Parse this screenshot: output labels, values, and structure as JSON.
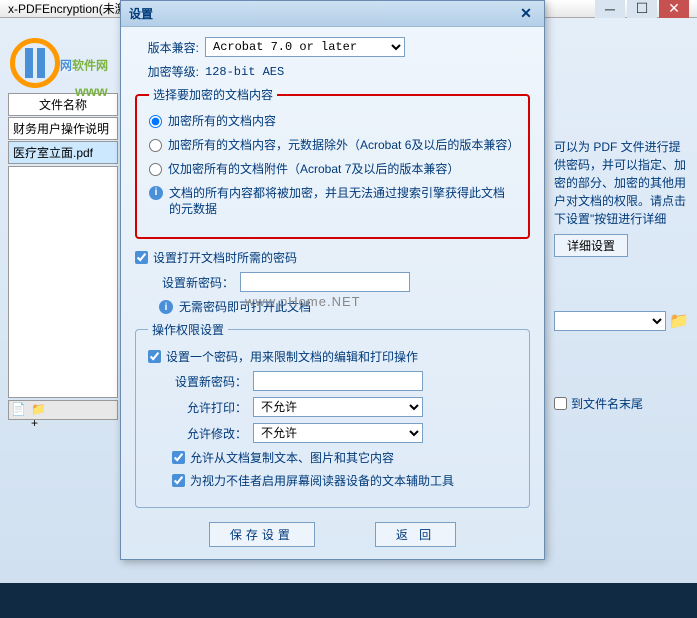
{
  "parent": {
    "title": "x-PDFEncryption(未激活)"
  },
  "watermark": {
    "t1": "网",
    "t2": "软件网",
    "url": "www",
    "center": "www.pHome.NET"
  },
  "left": {
    "header": "文件名称",
    "items": [
      "财务用户操作说明",
      "医疗室立面.pdf"
    ]
  },
  "right": {
    "help": "可以为 PDF 文件进行提供密码，并可以指定、加密的部分、加密的其他用户对文档的权限。请点击下设置\"按钮进行详细",
    "detail_btn": "详细设置",
    "append_label": "到文件名末尾"
  },
  "dialog": {
    "title": "设置",
    "labels": {
      "compat": "版本兼容:",
      "level": "加密等级:"
    },
    "compat_value": "Acrobat 7.0 or later",
    "level_value": "128-bit AES",
    "enc_group": {
      "legend": "选择要加密的文档内容",
      "opt1": "加密所有的文档内容",
      "opt2": "加密所有的文档内容，元数据除外（Acrobat 6及以后的版本兼容）",
      "opt3": "仅加密所有的文档附件（Acrobat 7及以后的版本兼容）",
      "info": "文档的所有内容都将被加密，并且无法通过搜索引擎获得此文档的元数据"
    },
    "open_pwd": {
      "cb": "设置打开文档时所需的密码",
      "label": "设置新密码：",
      "no_pwd": "无需密码即可打开此文档"
    },
    "perm": {
      "legend": "操作权限设置",
      "cb": "设置一个密码，用来限制文档的编辑和打印操作",
      "pwd_label": "设置新密码：",
      "print_label": "允许打印：",
      "print_val": "不允许",
      "modify_label": "允许修改：",
      "modify_val": "不允许",
      "cb_copy": "允许从文档复制文本、图片和其它内容",
      "cb_a11y": "为视力不佳者启用屏幕阅读器设备的文本辅助工具"
    },
    "buttons": {
      "save": "保存设置",
      "back": "返  回"
    }
  }
}
